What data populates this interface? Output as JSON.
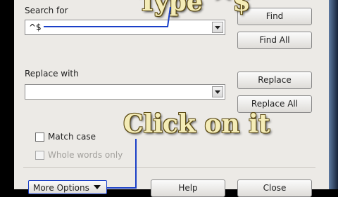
{
  "search": {
    "label": "Search for",
    "value": "^$",
    "find_button": "Find",
    "find_all_button": "Find All"
  },
  "replace": {
    "label": "Replace with",
    "value": "",
    "replace_button": "Replace",
    "replace_all_button": "Replace All"
  },
  "options": {
    "match_case": "Match case",
    "whole_words": "Whole words only",
    "more_options": "More Options"
  },
  "footer": {
    "help_button": "Help",
    "close_button": "Close"
  },
  "annotations": {
    "top_text": "Type ^$",
    "middle_text": "Click on it",
    "arrow_color": "#1a3fc7"
  }
}
